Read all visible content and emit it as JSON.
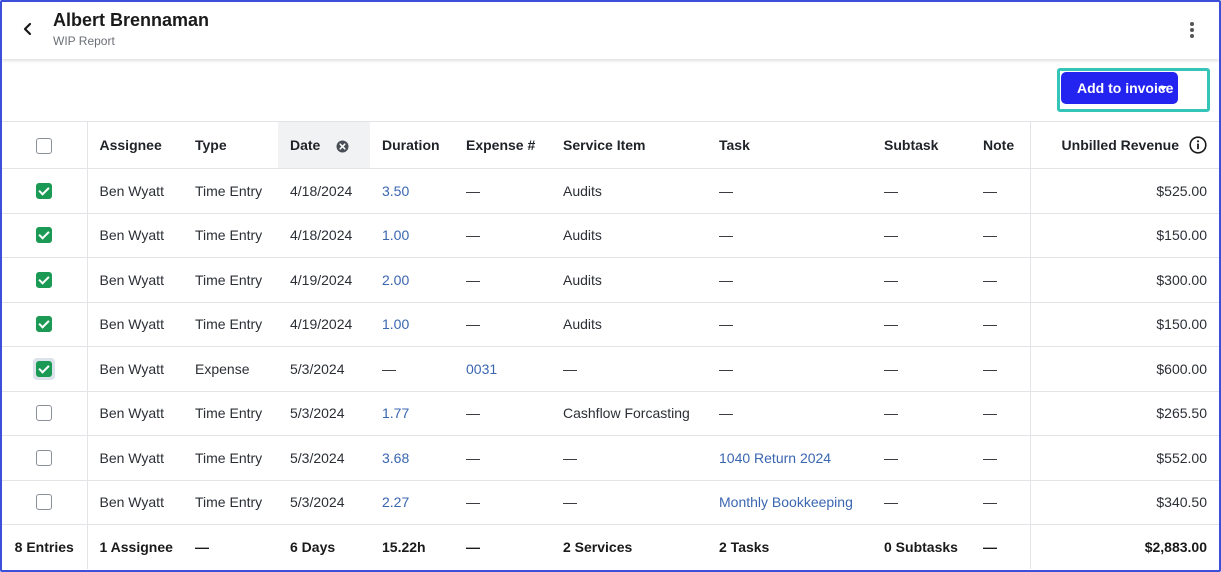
{
  "header": {
    "title": "Albert Brennaman",
    "subtitle": "WIP Report",
    "back_icon": "chevron-left-icon",
    "menu_icon": "kebab-menu-icon"
  },
  "toolbar": {
    "add_to_invoice_label": "Add to invoice",
    "accent_color": "#2424f0",
    "focus_ring_color": "#35c4b8"
  },
  "table": {
    "columns": {
      "assignee": "Assignee",
      "type": "Type",
      "date": "Date",
      "duration": "Duration",
      "expense": "Expense #",
      "service": "Service Item",
      "task": "Task",
      "subtask": "Subtask",
      "note": "Note",
      "revenue": "Unbilled Revenue"
    },
    "rows": [
      {
        "checked": true,
        "assignee": "Ben Wyatt",
        "type": "Time Entry",
        "date": "4/18/2024",
        "duration": "3.50",
        "expense": "—",
        "service": "Audits",
        "task": "—",
        "subtask": "—",
        "note": "—",
        "revenue": "$525.00"
      },
      {
        "checked": true,
        "assignee": "Ben Wyatt",
        "type": "Time Entry",
        "date": "4/18/2024",
        "duration": "1.00",
        "expense": "—",
        "service": "Audits",
        "task": "—",
        "subtask": "—",
        "note": "—",
        "revenue": "$150.00"
      },
      {
        "checked": true,
        "assignee": "Ben Wyatt",
        "type": "Time Entry",
        "date": "4/19/2024",
        "duration": "2.00",
        "expense": "—",
        "service": "Audits",
        "task": "—",
        "subtask": "—",
        "note": "—",
        "revenue": "$300.00"
      },
      {
        "checked": true,
        "assignee": "Ben Wyatt",
        "type": "Time Entry",
        "date": "4/19/2024",
        "duration": "1.00",
        "expense": "—",
        "service": "Audits",
        "task": "—",
        "subtask": "—",
        "note": "—",
        "revenue": "$150.00"
      },
      {
        "checked": true,
        "focused": true,
        "assignee": "Ben Wyatt",
        "type": "Expense",
        "date": "5/3/2024",
        "duration": "—",
        "expense": "0031",
        "service": "—",
        "task": "—",
        "subtask": "—",
        "note": "—",
        "revenue": "$600.00"
      },
      {
        "checked": false,
        "assignee": "Ben Wyatt",
        "type": "Time Entry",
        "date": "5/3/2024",
        "duration": "1.77",
        "expense": "—",
        "service": "Cashflow Forcasting",
        "task": "—",
        "subtask": "—",
        "note": "—",
        "revenue": "$265.50"
      },
      {
        "checked": false,
        "assignee": "Ben Wyatt",
        "type": "Time Entry",
        "date": "5/3/2024",
        "duration": "3.68",
        "expense": "—",
        "service": "—",
        "task": "1040 Return 2024",
        "subtask": "—",
        "note": "—",
        "revenue": "$552.00"
      },
      {
        "checked": false,
        "assignee": "Ben Wyatt",
        "type": "Time Entry",
        "date": "5/3/2024",
        "duration": "2.27",
        "expense": "—",
        "service": "—",
        "task": "Monthly Bookkeeping",
        "subtask": "—",
        "note": "—",
        "revenue": "$340.50"
      }
    ],
    "footer": {
      "entries": "8 Entries",
      "assignee": "1 Assignee",
      "type": "—",
      "date": "6 Days",
      "duration": "15.22h",
      "expense": "—",
      "service": "2 Services",
      "task": "2 Tasks",
      "subtask": "0 Subtasks",
      "note": "—",
      "revenue": "$2,883.00"
    },
    "link_color": "#3a66b0",
    "check_color": "#1a9a55"
  }
}
